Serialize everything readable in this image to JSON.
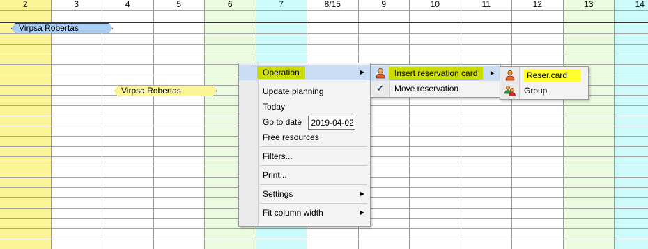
{
  "columns": [
    {
      "label": "2",
      "color": "yellow"
    },
    {
      "label": "3",
      "color": "white"
    },
    {
      "label": "4",
      "color": "white"
    },
    {
      "label": "5",
      "color": "white"
    },
    {
      "label": "6",
      "color": "green"
    },
    {
      "label": "7",
      "color": "cyan"
    },
    {
      "label": "8/15",
      "color": "white"
    },
    {
      "label": "9",
      "color": "white"
    },
    {
      "label": "10",
      "color": "white"
    },
    {
      "label": "11",
      "color": "white"
    },
    {
      "label": "12",
      "color": "white"
    },
    {
      "label": "13",
      "color": "green"
    },
    {
      "label": "14",
      "color": "cyan"
    }
  ],
  "colors": {
    "yellow": "#fbf598",
    "green": "#eafbe0",
    "cyan": "#cdfbfb",
    "booking_blue": "#a9cdf3",
    "highlight_green": "#cddc00",
    "highlight_yellow": "#ffff2d"
  },
  "bookings": [
    {
      "name": "Virpsa Robertas",
      "style": "blue"
    },
    {
      "name": "Virpsa Robertas",
      "style": "yellow"
    }
  ],
  "context_menu": {
    "items": {
      "operation": "Operation",
      "update_planning": "Update planning",
      "today": "Today",
      "go_to_date": "Go to date",
      "go_to_date_value": "2019-04-02",
      "free_resources": "Free resources",
      "filters": "Filters...",
      "print": "Print...",
      "settings": "Settings",
      "fit_column_width": "Fit column width"
    }
  },
  "operation_submenu": {
    "insert_reservation_card": "Insert reservation card",
    "move_reservation": "Move reservation"
  },
  "insert_submenu": {
    "reser_card": "Reser.card",
    "group": "Group"
  },
  "icons": {
    "arrow": "submenu-arrow-icon",
    "check": "checkmark-icon",
    "person": "person-icon",
    "group": "group-icon"
  }
}
